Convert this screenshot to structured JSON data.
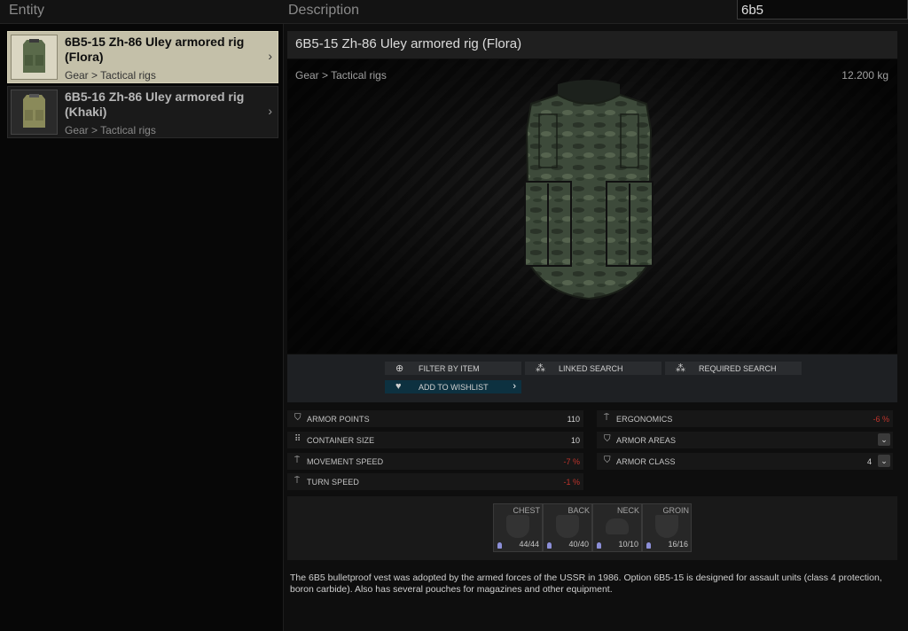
{
  "header": {
    "entity_label": "Entity",
    "description_label": "Description",
    "search_value": "6b5"
  },
  "entities": [
    {
      "name": "6B5-15 Zh-86 Uley armored rig (Flora)",
      "category": "Gear > Tactical rigs",
      "selected": true
    },
    {
      "name": "6B5-16 Zh-86 Uley armored rig (Khaki)",
      "category": "Gear > Tactical rigs",
      "selected": false
    }
  ],
  "detail": {
    "title": "6B5-15 Zh-86 Uley armored rig (Flora)",
    "category": "Gear > Tactical rigs",
    "weight": "12.200 kg",
    "actions": {
      "filter_by_item": "FILTER BY ITEM",
      "linked_search": "LINKED SEARCH",
      "required_search": "REQUIRED SEARCH",
      "add_to_wishlist": "ADD TO WISHLIST"
    },
    "stats": {
      "armor_points": {
        "label": "ARMOR POINTS",
        "value": "110"
      },
      "container_size": {
        "label": "CONTAINER SIZE",
        "value": "10"
      },
      "movement_speed": {
        "label": "MOVEMENT SPEED",
        "value": "-7 %"
      },
      "turn_speed": {
        "label": "TURN SPEED",
        "value": "-1 %"
      },
      "ergonomics": {
        "label": "ERGONOMICS",
        "value": "-6 %"
      },
      "armor_areas": {
        "label": "ARMOR AREAS",
        "value": ""
      },
      "armor_class": {
        "label": "ARMOR CLASS",
        "value": "4"
      }
    },
    "armor_zones": [
      {
        "name": "CHEST",
        "value": "44/44"
      },
      {
        "name": "BACK",
        "value": "40/40"
      },
      {
        "name": "NECK",
        "value": "10/10"
      },
      {
        "name": "GROIN",
        "value": "16/16"
      }
    ],
    "description": "The 6B5 bulletproof vest was adopted by the armed forces of the USSR in 1986. Option 6B5-15 is designed for assault units (class 4 protection, boron carbide). Also has several pouches for magazines and other equipment."
  },
  "colors": {
    "selected_item_bg": "#c4c0a9",
    "wishlist_bg": "#0d3140",
    "negative_value": "#c0342c",
    "armor_durability_icon": "#8c8fd8"
  }
}
